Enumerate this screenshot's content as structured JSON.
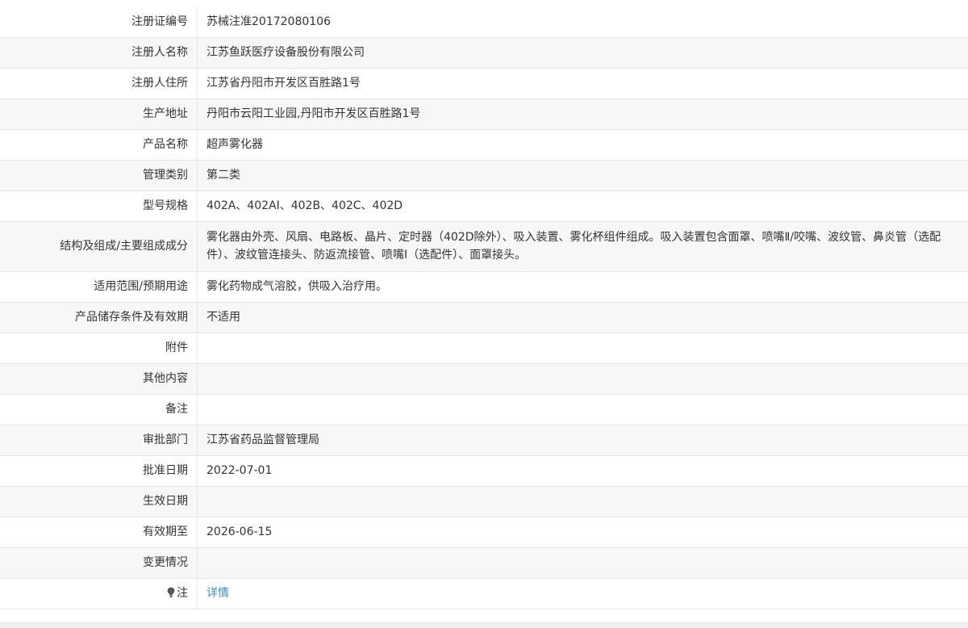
{
  "rows": [
    {
      "label": "注册证编号",
      "value": "苏械注准20172080106"
    },
    {
      "label": "注册人名称",
      "value": "江苏鱼跃医疗设备股份有限公司"
    },
    {
      "label": "注册人住所",
      "value": "江苏省丹阳市开发区百胜路1号"
    },
    {
      "label": "生产地址",
      "value": "丹阳市云阳工业园,丹阳市开发区百胜路1号"
    },
    {
      "label": "产品名称",
      "value": "超声雾化器"
    },
    {
      "label": "管理类别",
      "value": "第二类"
    },
    {
      "label": "型号规格",
      "value": "402A、402AI、402B、402C、402D"
    },
    {
      "label": "结构及组成/主要组成成分",
      "value": "雾化器由外壳、风扇、电路板、晶片、定时器（402D除外）、吸入装置、雾化杯组件组成。吸入装置包含面罩、喷嘴Ⅱ/咬嘴、波纹管、鼻炎管（选配件）、波纹管连接头、防返流接管、喷嘴Ⅰ（选配件）、面罩接头。"
    },
    {
      "label": "适用范围/预期用途",
      "value": "雾化药物成气溶胶，供吸入治疗用。"
    },
    {
      "label": "产品储存条件及有效期",
      "value": "不适用"
    },
    {
      "label": "附件",
      "value": ""
    },
    {
      "label": "其他内容",
      "value": ""
    },
    {
      "label": "备注",
      "value": ""
    },
    {
      "label": "审批部门",
      "value": "江苏省药品监督管理局"
    },
    {
      "label": "批准日期",
      "value": "2022-07-01"
    },
    {
      "label": "生效日期",
      "value": ""
    },
    {
      "label": "有效期至",
      "value": "2026-06-15"
    },
    {
      "label": "变更情况",
      "value": ""
    },
    {
      "label": "注",
      "value": "详情"
    }
  ],
  "colors": {
    "border": "#e5e5e5",
    "stripe": "#f7f7f7",
    "link": "#3a8ed6",
    "text": "#333333"
  },
  "icons": {
    "note": "lightbulb-icon"
  }
}
